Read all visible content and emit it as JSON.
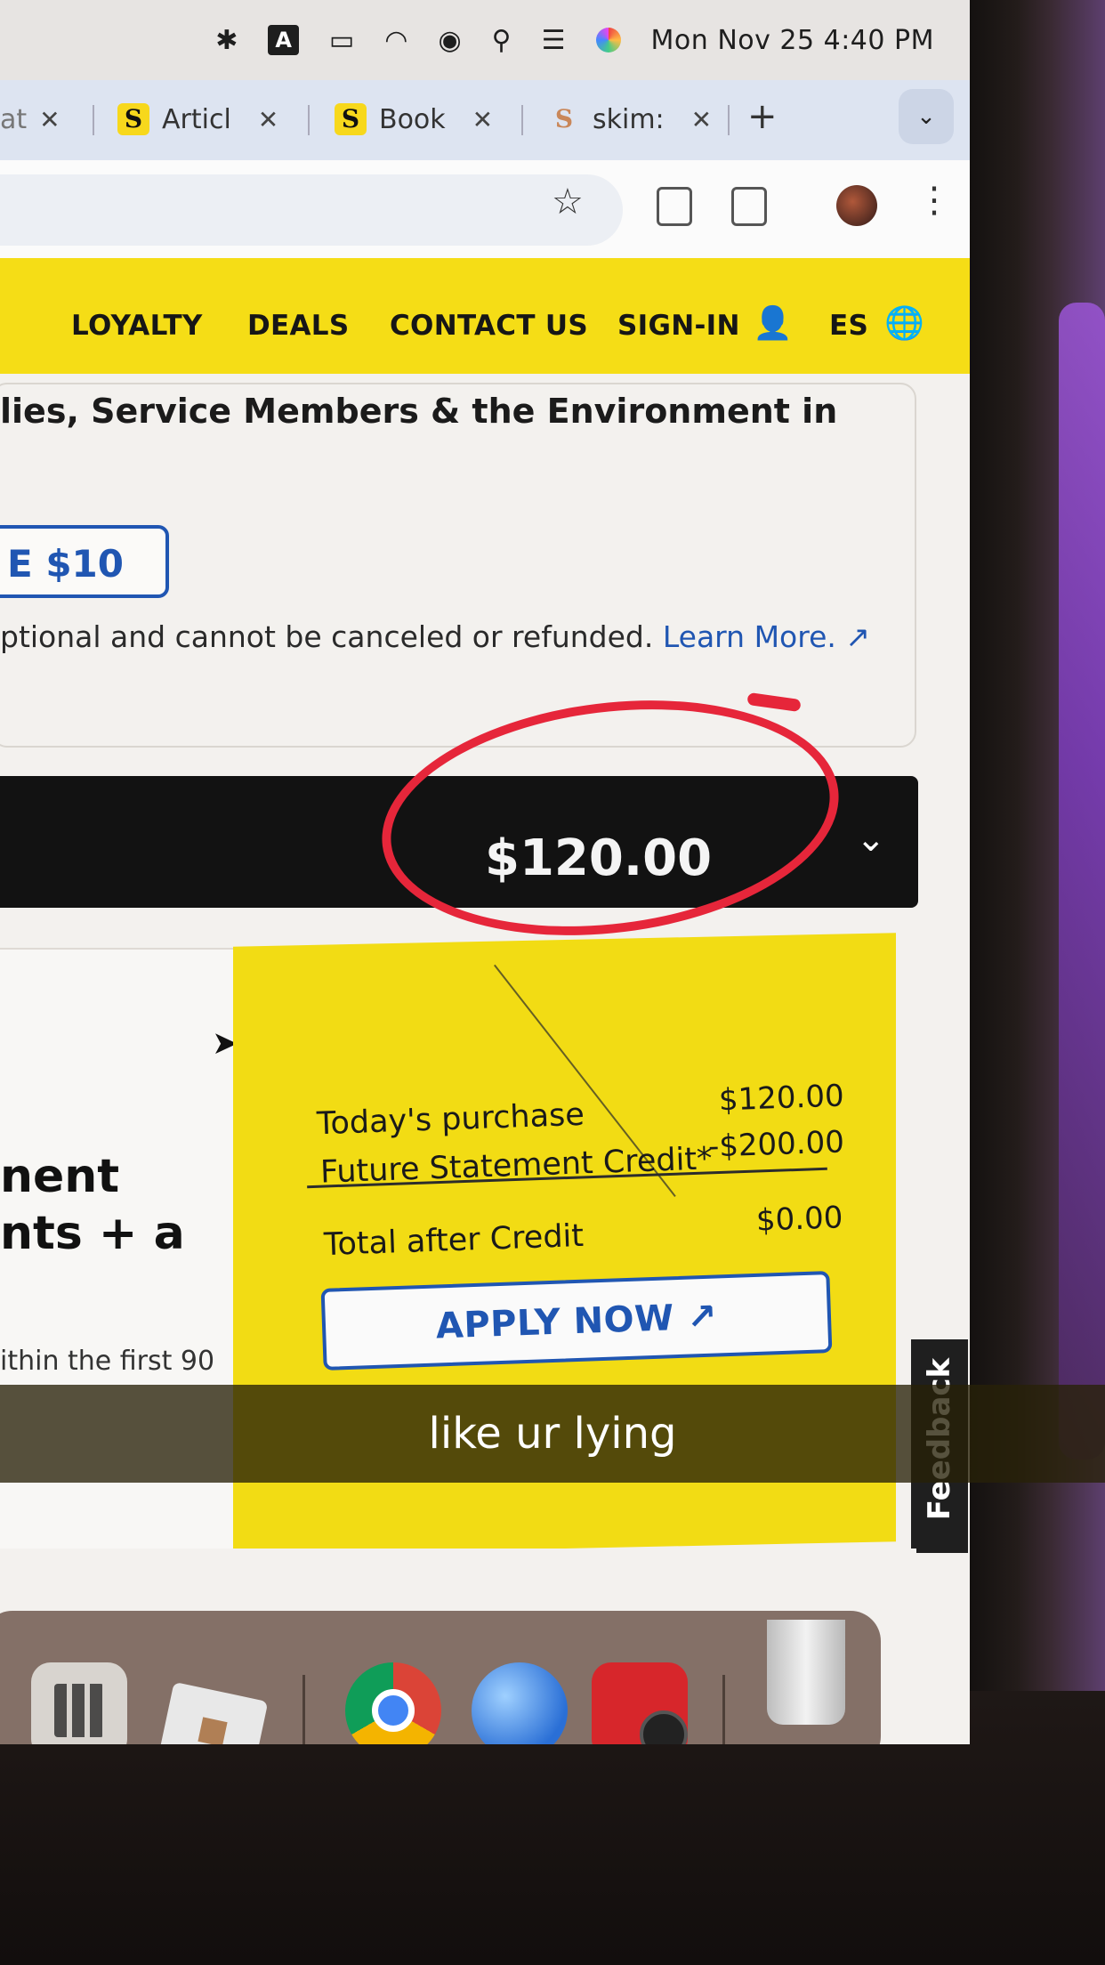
{
  "menubar": {
    "input_badge": "A",
    "clock": "Mon Nov 25  4:40 PM"
  },
  "tabs": [
    {
      "title": "at",
      "favicon": "S"
    },
    {
      "title": "Articl",
      "favicon": "S"
    },
    {
      "title": "Book",
      "favicon": "S"
    },
    {
      "title": "skim:",
      "favicon": "S"
    }
  ],
  "tabstrip": {
    "new_tab": "+",
    "menu": "⌄"
  },
  "sitenav": {
    "items": [
      "LOYALTY",
      "DEALS",
      "CONTACT US",
      "SIGN-IN",
      "ES"
    ]
  },
  "content": {
    "headline": "lies, Service Members & the Environment in",
    "donate_button": "E $10",
    "fineprint": "ptional and cannot be canceled or refunded.",
    "learn_more": "Learn More."
  },
  "price_bar": {
    "total": "$120.00"
  },
  "left_panel": {
    "title_fragment": "nent\nnts + a",
    "small_text": "ithin the first 90"
  },
  "promo": {
    "todays_purchase_label": "Today's purchase",
    "todays_purchase_value": "$120.00",
    "credit_label": "Future Statement Credit*",
    "credit_value": "-$200.00",
    "total_label": "Total after Credit",
    "total_value": "$0.00",
    "apply_button": "APPLY NOW"
  },
  "feedback_tab": "Feedback",
  "caption": "like ur lying",
  "colors": {
    "brand_yellow": "#f5dd16",
    "link_blue": "#2056b2",
    "annotation_red": "#e6263a"
  },
  "dock": {
    "icons": [
      "calculator-icon",
      "roblox-icon",
      "chrome-icon",
      "network-globe-icon",
      "photo-booth-icon",
      "trash-icon"
    ]
  }
}
